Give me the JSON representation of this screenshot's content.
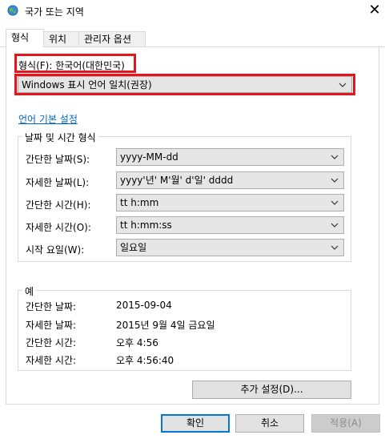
{
  "window": {
    "title": "국가 또는 지역",
    "close_glyph": "✕"
  },
  "tabs": [
    {
      "label": "형식"
    },
    {
      "label": "위치"
    },
    {
      "label": "관리자 옵션"
    }
  ],
  "format": {
    "label": "형식(F): 한국어(대한민국)",
    "dropdown_value": "Windows 표시 언어 일치(권장)",
    "language_link": "언어 기본 설정"
  },
  "date_time_group": {
    "title": "날짜 및 시간 형식",
    "rows": [
      {
        "label": "간단한 날짜(S):",
        "value": "yyyy-MM-dd"
      },
      {
        "label": "자세한 날짜(L):",
        "value": "yyyy'년' M'월' d'일' dddd"
      },
      {
        "label": "간단한 시간(H):",
        "value": "tt h:mm"
      },
      {
        "label": "자세한 시간(O):",
        "value": "tt h:mm:ss"
      },
      {
        "label": "시작 요일(W):",
        "value": "일요일"
      }
    ]
  },
  "example_group": {
    "title": "예",
    "rows": [
      {
        "label": "간단한 날짜:",
        "value": "2015-09-04"
      },
      {
        "label": "자세한 날짜:",
        "value": "2015년 9월 4일 금요일"
      },
      {
        "label": "간단한 시간:",
        "value": "오후 4:56"
      },
      {
        "label": "자세한 시간:",
        "value": "오후 4:56:40"
      }
    ]
  },
  "buttons": {
    "additional": "추가 설정(D)...",
    "ok": "확인",
    "cancel": "취소",
    "apply": "적용(A)"
  },
  "colors": {
    "highlight": "#e8141b",
    "link": "#0066cc",
    "default_button_border": "#0078d7"
  }
}
